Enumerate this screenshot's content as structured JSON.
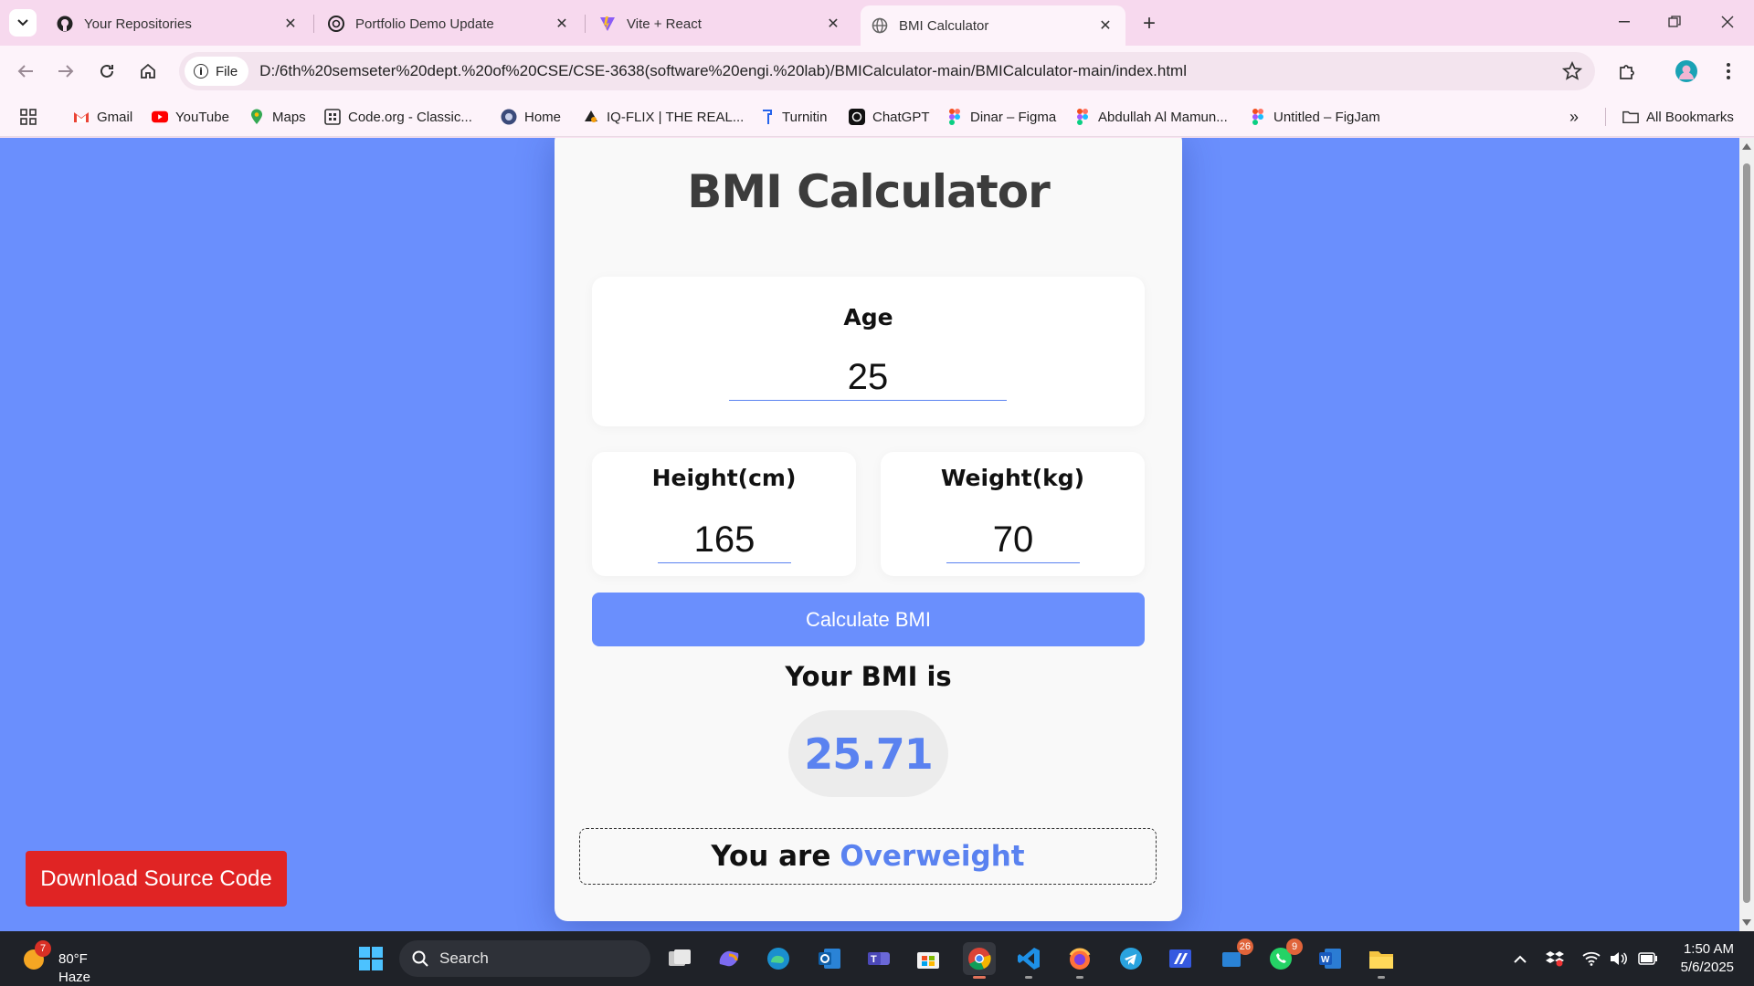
{
  "browser": {
    "tabs": [
      {
        "title": "Your Repositories",
        "icon": "github-icon",
        "active": false
      },
      {
        "title": "Portfolio Demo Update",
        "icon": "openai-icon",
        "active": false
      },
      {
        "title": "Vite + React",
        "icon": "vite-icon",
        "active": false
      },
      {
        "title": "BMI Calculator",
        "icon": "globe-icon",
        "active": true
      }
    ],
    "address": {
      "chip_label": "File",
      "url": "D:/6th%20semseter%20dept.%20of%20CSE/CSE-3638(software%20engi.%20lab)/BMICalculator-main/BMICalculator-main/index.html"
    },
    "bookmarks": [
      {
        "label": "Gmail",
        "icon": "gmail-icon"
      },
      {
        "label": "YouTube",
        "icon": "youtube-icon"
      },
      {
        "label": "Maps",
        "icon": "maps-icon"
      },
      {
        "label": "Code.org - Classic...",
        "icon": "codeorg-icon"
      },
      {
        "label": "Home",
        "icon": "home-site-icon"
      },
      {
        "label": "IQ-FLIX | THE REAL...",
        "icon": "iqflix-icon"
      },
      {
        "label": "Turnitin",
        "icon": "turnitin-icon"
      },
      {
        "label": "ChatGPT",
        "icon": "chatgpt-icon"
      },
      {
        "label": "Dinar – Figma",
        "icon": "figma-icon"
      },
      {
        "label": "Abdullah Al Mamun...",
        "icon": "figma-icon"
      },
      {
        "label": "Untitled – FigJam",
        "icon": "figma-icon"
      }
    ],
    "all_bookmarks_label": "All Bookmarks"
  },
  "page": {
    "title": "BMI Calculator",
    "age": {
      "label": "Age",
      "value": "25"
    },
    "height": {
      "label": "Height(cm)",
      "value": "165"
    },
    "weight": {
      "label": "Weight(kg)",
      "value": "70"
    },
    "calculate_label": "Calculate BMI",
    "result_heading": "Your BMI is",
    "bmi_value": "25.71",
    "status_prefix": "You are",
    "status_category": "Overweight",
    "download_label": "Download Source Code",
    "colors": {
      "background": "#6a8ffd",
      "accent": "#5a82f0",
      "download": "#e02424"
    }
  },
  "taskbar": {
    "weather": {
      "temp": "80°F",
      "condition": "Haze",
      "badge": "7"
    },
    "search_label": "Search",
    "badges": {
      "outlook_store": "26",
      "whatsapp": "9"
    },
    "time": "1:50 AM",
    "date": "5/6/2025"
  }
}
